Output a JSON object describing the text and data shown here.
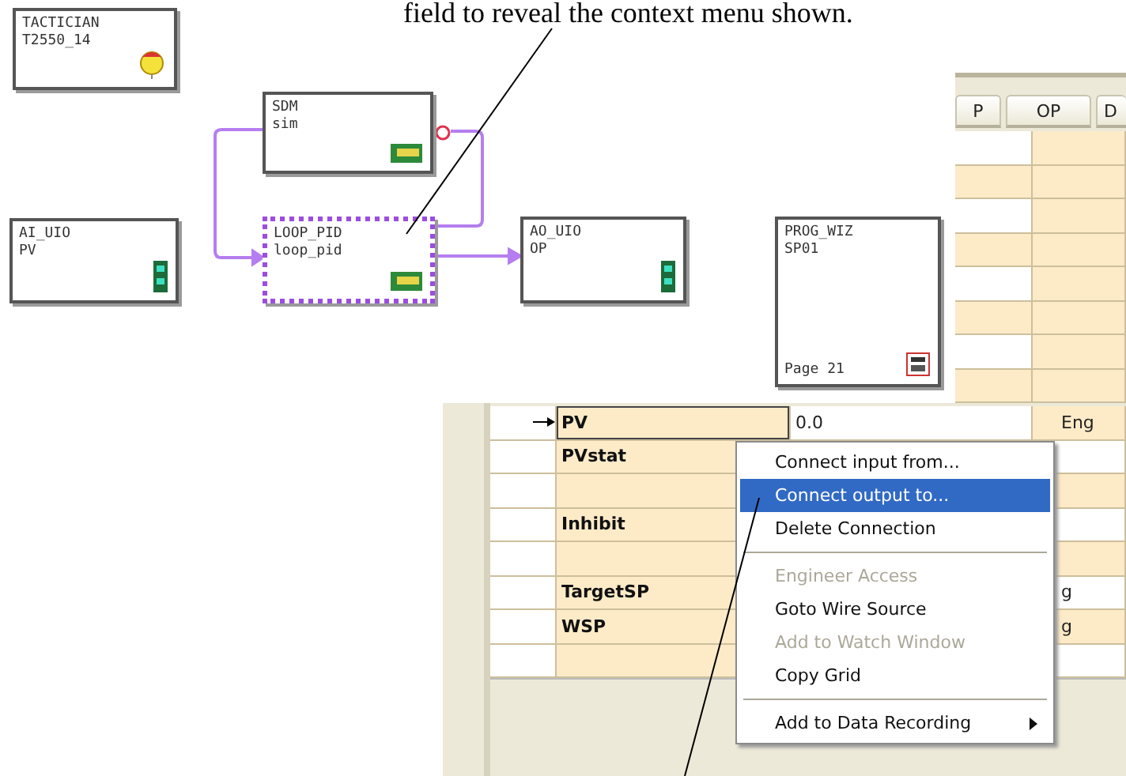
{
  "caption": "field to reveal the context menu shown.",
  "diagram": {
    "blocks": [
      {
        "kind": "tactician",
        "line1": "TACTICIAN",
        "line2": "T2550_14",
        "selected": false
      },
      {
        "kind": "function",
        "line1": "SDM",
        "line2": "sim",
        "selected": false
      },
      {
        "kind": "io",
        "line1": "AI_UIO",
        "line2": "PV",
        "selected": false
      },
      {
        "kind": "function",
        "line1": "LOOP_PID",
        "line2": "loop_pid",
        "selected": true
      },
      {
        "kind": "io",
        "line1": "AO_UIO",
        "line2": "OP",
        "selected": false
      },
      {
        "kind": "program",
        "line1": "PROG_WIZ",
        "line2": "SP01",
        "footer": "Page 21",
        "selected": false
      }
    ]
  },
  "grid": {
    "columns": [
      {
        "label": "P"
      },
      {
        "label": "OP"
      },
      {
        "label": "D"
      }
    ],
    "rows": [
      {
        "name": "PV",
        "value": "0.0",
        "unit": "Eng",
        "selected": true,
        "connected": true
      },
      {
        "name": "PVstat",
        "selected": false,
        "connected": false
      },
      {
        "selected": false,
        "connected": false
      },
      {
        "name": "Inhibit",
        "selected": false,
        "connected": false
      },
      {
        "selected": false,
        "connected": false
      },
      {
        "name": "TargetSP",
        "unit": "g",
        "selected": false,
        "connected": false
      },
      {
        "name": "WSP",
        "unit": "g",
        "selected": false,
        "connected": false
      },
      {
        "selected": false,
        "connected": false
      }
    ]
  },
  "context_menu": {
    "items": [
      {
        "kind": "item",
        "label": "Connect input from...",
        "selected": false,
        "disabled": false
      },
      {
        "kind": "item",
        "label": "Connect output to...",
        "selected": true,
        "disabled": false
      },
      {
        "kind": "item",
        "label": "Delete Connection",
        "selected": false,
        "disabled": false
      },
      {
        "kind": "separator"
      },
      {
        "kind": "item",
        "label": "Engineer Access",
        "selected": false,
        "disabled": true
      },
      {
        "kind": "item",
        "label": "Goto Wire Source",
        "selected": false,
        "disabled": false
      },
      {
        "kind": "item",
        "label": "Add to Watch Window",
        "selected": false,
        "disabled": true
      },
      {
        "kind": "item",
        "label": "Copy Grid",
        "selected": false,
        "disabled": false
      },
      {
        "kind": "separator"
      },
      {
        "kind": "submenu",
        "label": "Add to Data Recording",
        "selected": false,
        "disabled": false
      }
    ]
  }
}
